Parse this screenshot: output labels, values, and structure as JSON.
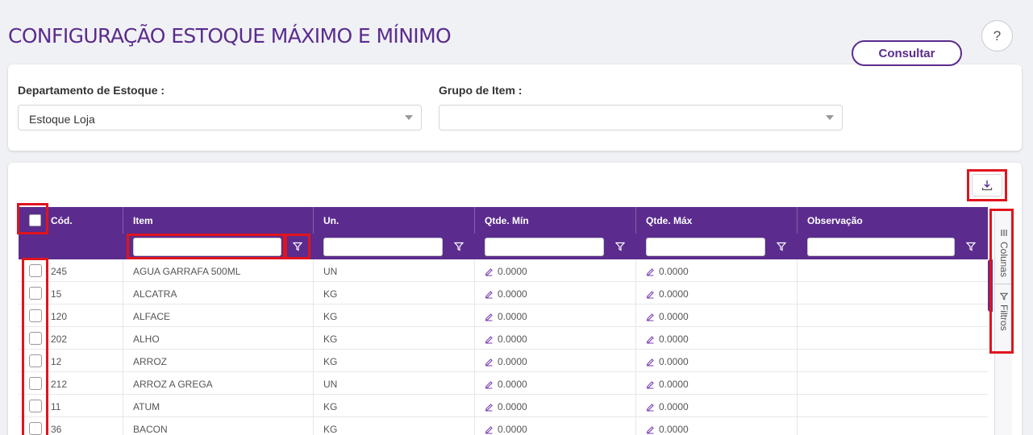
{
  "page": {
    "title": "CONFIGURAÇÃO ESTOQUE MÁXIMO E MÍNIMO",
    "help_label": "?"
  },
  "filters": {
    "department_label": "Departamento de Estoque :",
    "department_value": "Estoque Loja",
    "group_label": "Grupo de Item :",
    "group_value": "",
    "consult_label": "Consultar"
  },
  "grid": {
    "columns": [
      "Cód.",
      "Item",
      "Un.",
      "Qtde. Mín",
      "Qtde. Máx",
      "Observação"
    ],
    "rows": [
      {
        "cod": "245",
        "item": "AGUA GARRAFA 500ML",
        "un": "UN",
        "min": "0.0000",
        "max": "0.0000",
        "obs": ""
      },
      {
        "cod": "15",
        "item": "ALCATRA",
        "un": "KG",
        "min": "0.0000",
        "max": "0.0000",
        "obs": ""
      },
      {
        "cod": "120",
        "item": "ALFACE",
        "un": "KG",
        "min": "0.0000",
        "max": "0.0000",
        "obs": ""
      },
      {
        "cod": "202",
        "item": "ALHO",
        "un": "KG",
        "min": "0.0000",
        "max": "0.0000",
        "obs": ""
      },
      {
        "cod": "12",
        "item": "ARROZ",
        "un": "KG",
        "min": "0.0000",
        "max": "0.0000",
        "obs": ""
      },
      {
        "cod": "212",
        "item": "ARROZ A GREGA",
        "un": "UN",
        "min": "0.0000",
        "max": "0.0000",
        "obs": ""
      },
      {
        "cod": "11",
        "item": "ATUM",
        "un": "KG",
        "min": "0.0000",
        "max": "0.0000",
        "obs": ""
      },
      {
        "cod": "36",
        "item": "BACON",
        "un": "KG",
        "min": "0.0000",
        "max": "0.0000",
        "obs": ""
      }
    ]
  },
  "side_panel": {
    "columns_label": "Colunas",
    "filters_label": "Filtros"
  },
  "icons": {
    "help": "question-icon",
    "export": "download-icon",
    "filter": "funnel-icon",
    "edit": "pencil-icon",
    "columns": "columns-icon",
    "side_filter": "funnel-icon"
  },
  "colors": {
    "brand": "#5b2c8d",
    "highlight": "#e0141e"
  }
}
